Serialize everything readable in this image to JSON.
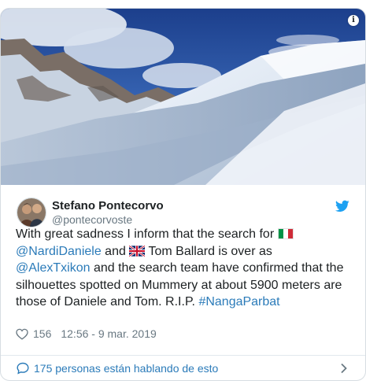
{
  "author": {
    "name": "Stefano Pontecorvo",
    "handle": "@pontecorvoste"
  },
  "tweet": {
    "p1": "With great sadness I inform that the search for ",
    "mention1": "@NardiDaniele",
    "p2": " and ",
    "p3": " Tom Ballard is over as ",
    "mention2": "@AlexTxikon",
    "p4": " and the search team have confirmed that the silhouettes spotted on Mummery at about 5900 meters are those of Daniele and Tom. R.I.P. ",
    "hashtag": "#NangaParbat"
  },
  "meta": {
    "likes": "156",
    "timestamp": "12:56 - 9 mar. 2019"
  },
  "footer": {
    "replies_label": "175 personas están hablando de esto"
  },
  "colors": {
    "link": "#2b7bb9",
    "twitter_blue": "#1da1f2",
    "secondary_text": "#697882"
  },
  "icons": {
    "info": "info-icon",
    "bird": "twitter-bird-icon",
    "heart": "heart-icon",
    "reply": "speech-bubble-icon",
    "chevron": "chevron-right-icon",
    "flag_it": "italy-flag-icon",
    "flag_uk": "uk-flag-icon"
  }
}
